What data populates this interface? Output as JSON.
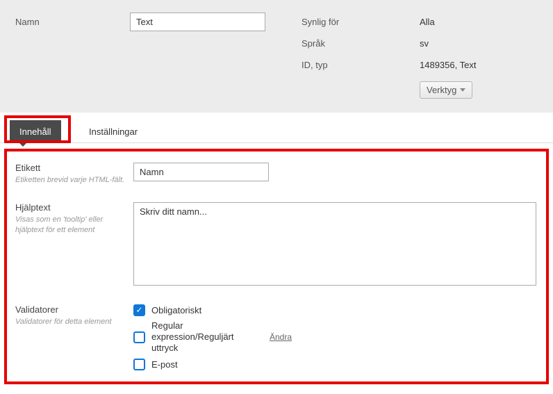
{
  "header": {
    "name_label": "Namn",
    "name_value": "Text",
    "meta": {
      "visible_label": "Synlig för",
      "visible_value": "Alla",
      "lang_label": "Språk",
      "lang_value": "sv",
      "idtype_label": "ID, typ",
      "idtype_value": "1489356, Text"
    },
    "tools_label": "Verktyg"
  },
  "tabs": {
    "content": "Innehåll",
    "settings": "Inställningar"
  },
  "form": {
    "etikett": {
      "label": "Etikett",
      "help": "Etiketten brevid varje HTML-fält.",
      "value": "Namn"
    },
    "helptext": {
      "label": "Hjälptext",
      "help": "Visas som en 'tooltip' eller hjälptext för ett element",
      "value": "Skriv ditt namn..."
    },
    "validators": {
      "label": "Validatorer",
      "help": "Validatorer för detta element",
      "required": "Obligatoriskt",
      "regex": "Regular expression/Reguljärt uttryck",
      "regex_change": "Ändra",
      "email": "E-post"
    }
  }
}
